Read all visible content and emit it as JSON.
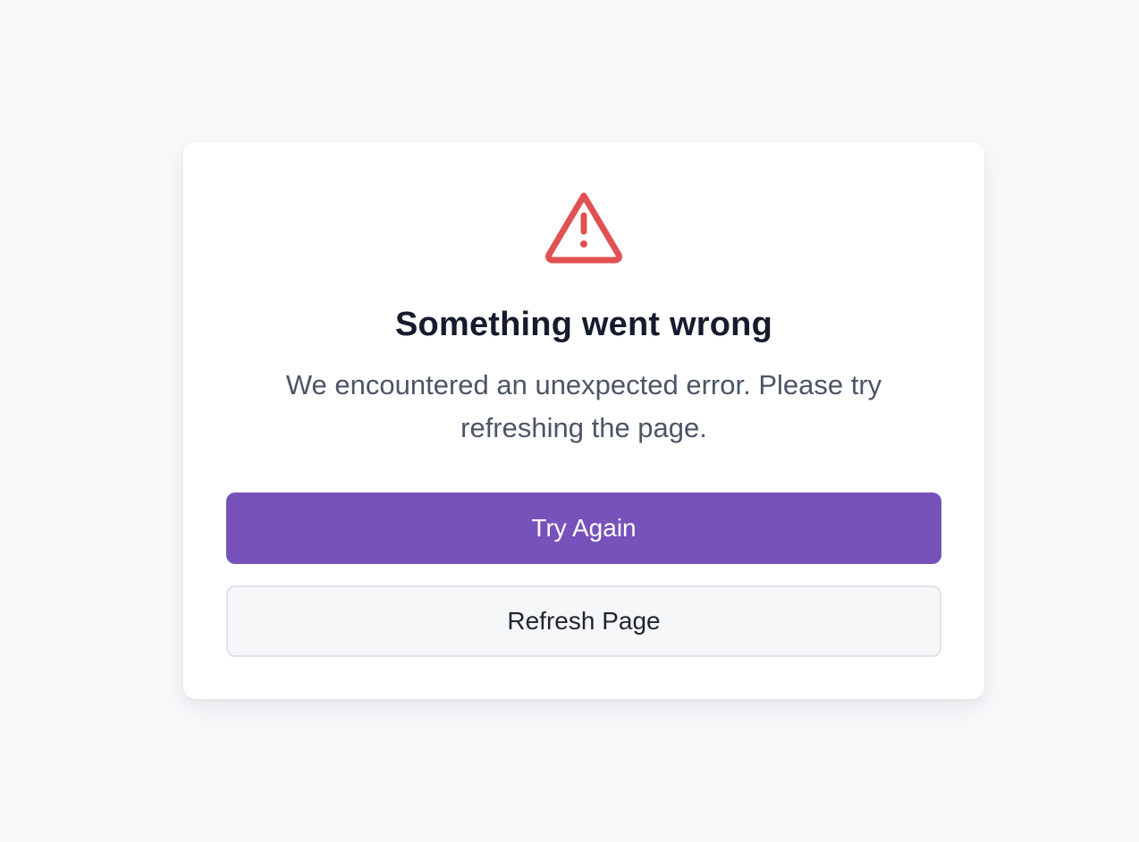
{
  "error_card": {
    "icon": "warning-triangle-icon",
    "icon_color": "#e05252",
    "title": "Something went wrong",
    "message": "We encountered an unexpected error. Please try refreshing the page.",
    "primary_button_label": "Try Again",
    "primary_button_color": "#7752bb",
    "secondary_button_label": "Refresh Page"
  }
}
